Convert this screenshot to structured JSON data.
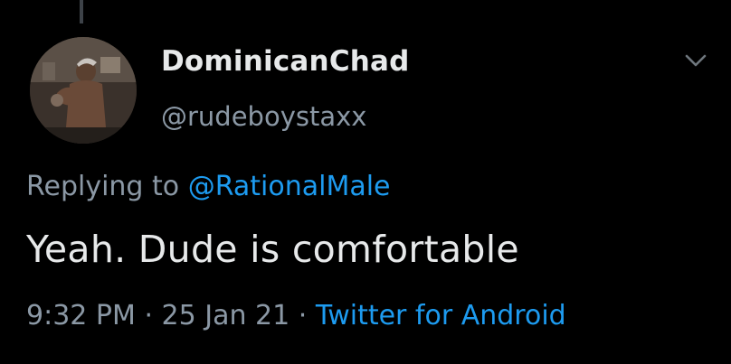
{
  "tweet": {
    "author": {
      "display_name": "DominicanChad",
      "handle": "@rudeboystaxx",
      "avatar_icon": "profile-photo"
    },
    "menu_icon": "chevron-down-icon",
    "replying_prefix": "Replying to",
    "replying_to": "@RationalMale",
    "text": "Yeah. Dude is comfortable",
    "time": "9:32 PM",
    "separator": "·",
    "date": "25 Jan 21",
    "source": "Twitter for Android"
  },
  "colors": {
    "background": "#000000",
    "primary_text": "#e7e9ea",
    "secondary_text": "#8b98a5",
    "link": "#1d9bf0"
  }
}
